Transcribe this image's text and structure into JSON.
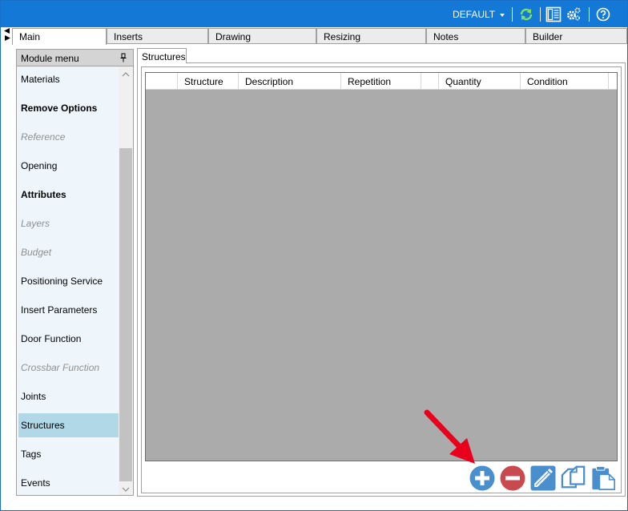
{
  "titlebar": {
    "profile_label": "DEFAULT",
    "icons": [
      "refresh-icon",
      "layout-icon",
      "settings-icon",
      "help-icon"
    ]
  },
  "tabs": [
    {
      "label": "Main",
      "active": true
    },
    {
      "label": "Inserts",
      "active": false
    },
    {
      "label": "Drawing",
      "active": false
    },
    {
      "label": "Resizing",
      "active": false
    },
    {
      "label": "Notes",
      "active": false
    },
    {
      "label": "Builder",
      "active": false
    }
  ],
  "menu": {
    "title": "Module menu",
    "items": [
      {
        "label": "Materials",
        "style": "normal"
      },
      {
        "label": "Remove Options",
        "style": "bold"
      },
      {
        "label": "Reference",
        "style": "disabled"
      },
      {
        "label": "Opening",
        "style": "normal"
      },
      {
        "label": "Attributes",
        "style": "bold"
      },
      {
        "label": "Layers",
        "style": "disabled"
      },
      {
        "label": "Budget",
        "style": "disabled"
      },
      {
        "label": "Positioning Service",
        "style": "normal"
      },
      {
        "label": "Insert Parameters",
        "style": "normal"
      },
      {
        "label": "Door Function",
        "style": "normal"
      },
      {
        "label": "Crossbar Function",
        "style": "disabled"
      },
      {
        "label": "Joints",
        "style": "normal"
      },
      {
        "label": "Structures",
        "style": "selected"
      },
      {
        "label": "Tags",
        "style": "normal"
      },
      {
        "label": "Events",
        "style": "normal"
      }
    ]
  },
  "structures": {
    "tab_label": "Structures",
    "columns": [
      "",
      "Structure",
      "Description",
      "Repetition",
      "",
      "Quantity",
      "Condition"
    ],
    "rows": []
  },
  "actions": [
    "add-icon",
    "remove-icon",
    "edit-icon",
    "copy-icon",
    "paste-icon"
  ],
  "colors": {
    "titlebar": "#1479d6",
    "selected_item": "#b0d8e6",
    "action_blue": "#4a8fcd",
    "action_red": "#c94a4e",
    "arrow": "#e8001c"
  }
}
